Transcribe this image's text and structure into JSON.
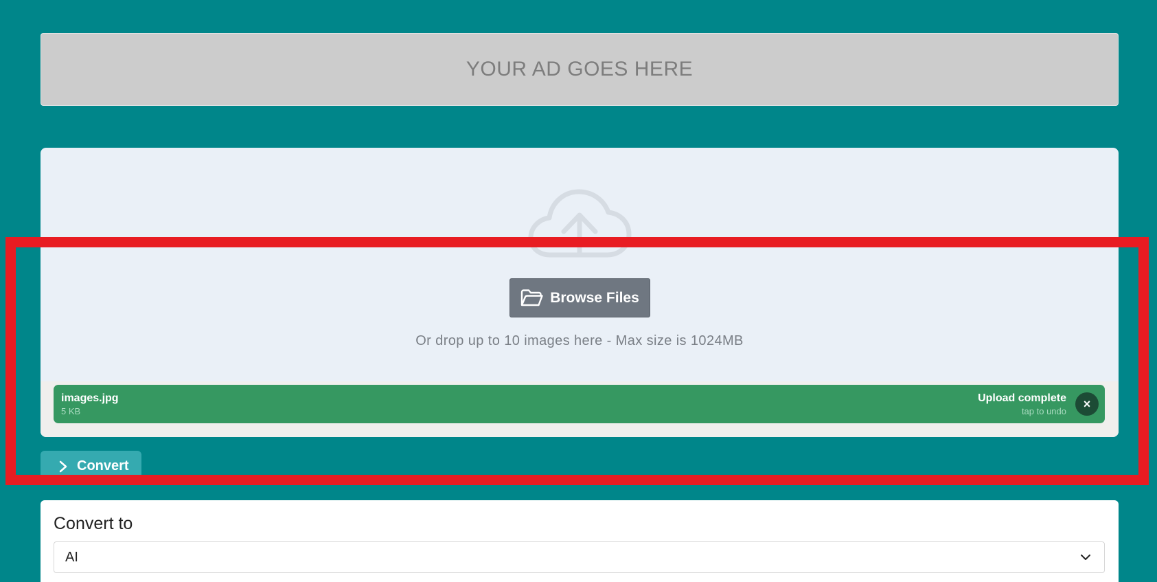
{
  "ad": {
    "text": "YOUR AD GOES HERE"
  },
  "uploader": {
    "upload_icon": "cloud-upload-icon",
    "browse_label": "Browse Files",
    "browse_icon": "folder-open-icon",
    "drop_hint": "Or drop up to 10 images here - Max size is 1024MB",
    "file": {
      "name": "images.jpg",
      "size": "5 KB",
      "status": "Upload complete",
      "undo_hint": "tap to undo",
      "remove_icon": "close-icon"
    }
  },
  "convert_tab": {
    "label": "Convert",
    "icon": "chevron-right-icon"
  },
  "convert_form": {
    "label": "Convert to",
    "selected_value": "AI",
    "select_icon": "chevron-down-icon"
  },
  "highlight": {
    "color": "#e81c22"
  },
  "colors": {
    "page_background": "#00868a",
    "success": "#369861",
    "button": "#6f7781",
    "tab": "#35aab0"
  }
}
